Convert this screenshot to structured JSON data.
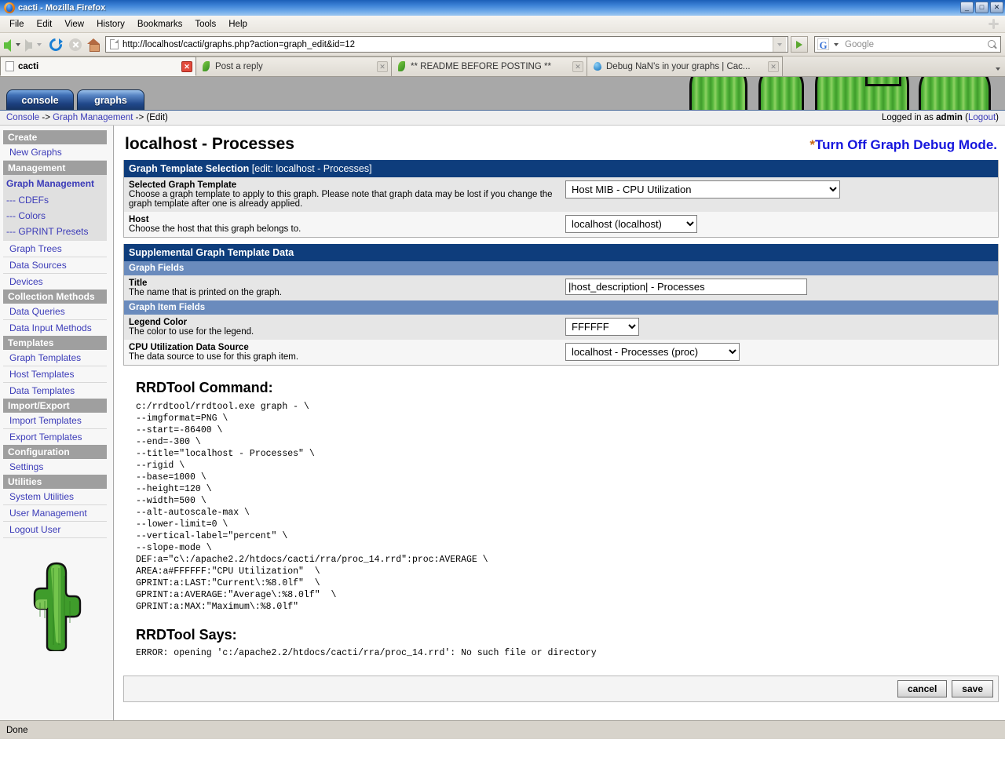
{
  "window": {
    "title": "cacti - Mozilla Firefox",
    "minimize": "_",
    "restore": "□",
    "close": "✕"
  },
  "menubar": {
    "items": [
      "File",
      "Edit",
      "View",
      "History",
      "Bookmarks",
      "Tools",
      "Help"
    ]
  },
  "toolbar": {
    "url": "http://localhost/cacti/graphs.php?action=graph_edit&id=12",
    "search_placeholder": "Google",
    "back_icon": "back-arrow-icon",
    "forward_icon": "forward-arrow-icon",
    "reload_icon": "reload-icon",
    "stop_icon": "stop-icon",
    "home_icon": "home-icon",
    "go_icon": "go-arrow-icon",
    "search_icon": "magnifier-icon"
  },
  "browser_tabs": [
    {
      "label": "cacti",
      "active": true,
      "icon": "page-icon",
      "close": "✕"
    },
    {
      "label": "Post a reply",
      "active": false,
      "icon": "leaf-icon",
      "close": "✕"
    },
    {
      "label": "** README BEFORE POSTING **",
      "active": false,
      "icon": "leaf-icon",
      "close": "✕"
    },
    {
      "label": "Debug NaN's in your graphs | Cac...",
      "active": false,
      "icon": "droplet-icon",
      "close": "✕"
    }
  ],
  "cacti_tabs": [
    {
      "label": "console",
      "selected": false
    },
    {
      "label": "graphs",
      "selected": true
    }
  ],
  "breadcrumb": {
    "console": "Console",
    "sep1": " -> ",
    "management": "Graph Management",
    "sep2": " -> ",
    "current": "(Edit)",
    "logged_in_prefix": "Logged in as ",
    "user": "admin",
    "logout_open": " (",
    "logout": "Logout",
    "logout_close": ")"
  },
  "sidebar": {
    "sections": [
      {
        "type": "header",
        "label": "Create"
      },
      {
        "type": "link",
        "label": "New Graphs"
      },
      {
        "type": "header",
        "label": "Management"
      },
      {
        "type": "current",
        "label": "Graph Management"
      },
      {
        "type": "sub",
        "label": "--- CDEFs"
      },
      {
        "type": "sub",
        "label": "--- Colors"
      },
      {
        "type": "sub",
        "label": "--- GPRINT Presets"
      },
      {
        "type": "link",
        "label": "Graph Trees"
      },
      {
        "type": "link",
        "label": "Data Sources"
      },
      {
        "type": "link",
        "label": "Devices"
      },
      {
        "type": "header",
        "label": "Collection Methods"
      },
      {
        "type": "link",
        "label": "Data Queries"
      },
      {
        "type": "link",
        "label": "Data Input Methods"
      },
      {
        "type": "header",
        "label": "Templates"
      },
      {
        "type": "link",
        "label": "Graph Templates"
      },
      {
        "type": "link",
        "label": "Host Templates"
      },
      {
        "type": "link",
        "label": "Data Templates"
      },
      {
        "type": "header",
        "label": "Import/Export"
      },
      {
        "type": "link",
        "label": "Import Templates"
      },
      {
        "type": "link",
        "label": "Export Templates"
      },
      {
        "type": "header",
        "label": "Configuration"
      },
      {
        "type": "link",
        "label": "Settings"
      },
      {
        "type": "header",
        "label": "Utilities"
      },
      {
        "type": "link",
        "label": "System Utilities"
      },
      {
        "type": "link",
        "label": "User Management"
      },
      {
        "type": "link",
        "label": "Logout User"
      }
    ],
    "logo": "cactus-logo"
  },
  "main": {
    "page_title": "localhost - Processes",
    "debug_star": "*",
    "debug_link": "Turn Off Graph Debug Mode.",
    "template_panel": {
      "title": "Graph Template Selection",
      "title_sub": "[edit: localhost - Processes]",
      "rows": [
        {
          "label": "Selected Graph Template",
          "desc": "Choose a graph template to apply to this graph. Please note that graph data may be lost if you change the graph template after one is already applied.",
          "value": "Host MIB - CPU Utilization"
        },
        {
          "label": "Host",
          "desc": "Choose the host that this graph belongs to.",
          "value": "localhost (localhost)"
        }
      ]
    },
    "supplemental_panel": {
      "title": "Supplemental Graph Template Data",
      "graph_fields_bar": "Graph Fields",
      "graph_item_fields_bar": "Graph Item Fields",
      "title_row": {
        "label": "Title",
        "desc": "The name that is printed on the graph.",
        "value": "|host_description| - Processes"
      },
      "legend_color_row": {
        "label": "Legend Color",
        "desc": "The color to use for the legend.",
        "value": "FFFFFF"
      },
      "data_source_row": {
        "label": "CPU Utilization Data Source",
        "desc": "The data source to use for this graph item.",
        "value": "localhost - Processes (proc)"
      }
    },
    "rrdtool_command_heading": "RRDTool Command:",
    "rrdtool_command": "c:/rrdtool/rrdtool.exe graph - \\\n--imgformat=PNG \\\n--start=-86400 \\\n--end=-300 \\\n--title=\"localhost - Processes\" \\\n--rigid \\\n--base=1000 \\\n--height=120 \\\n--width=500 \\\n--alt-autoscale-max \\\n--lower-limit=0 \\\n--vertical-label=\"percent\" \\\n--slope-mode \\\nDEF:a=\"c\\:/apache2.2/htdocs/cacti/rra/proc_14.rrd\":proc:AVERAGE \\\nAREA:a#FFFFFF:\"CPU Utilization\"  \\\nGPRINT:a:LAST:\"Current\\:%8.0lf\"  \\\nGPRINT:a:AVERAGE:\"Average\\:%8.0lf\"  \\\nGPRINT:a:MAX:\"Maximum\\:%8.0lf\"",
    "rrdtool_says_heading": "RRDTool Says:",
    "rrdtool_says": "ERROR: opening 'c:/apache2.2/htdocs/cacti/rra/proc_14.rrd': No such file or directory",
    "buttons": {
      "cancel": "cancel",
      "save": "save"
    }
  },
  "statusbar": {
    "text": "Done"
  },
  "colors": {
    "panel_title_bg": "#0e3d7c",
    "subbar_bg": "#6a8bbd",
    "link": "#3b3bb8",
    "debug_link": "#1515dd",
    "star": "#c86a18",
    "sidebar_header_bg": "#9f9f9f",
    "banner_bg": "#a8a8a8"
  }
}
